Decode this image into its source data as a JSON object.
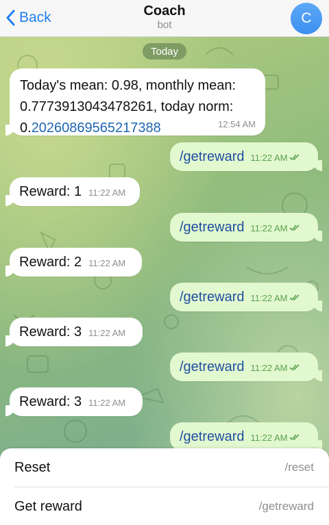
{
  "header": {
    "back_label": "Back",
    "title": "Coach",
    "subtitle": "bot",
    "avatar_letter": "C"
  },
  "date_separator": "Today",
  "messages": [
    {
      "direction": "incoming",
      "lines": [
        "Today's mean: 0.98, monthly mean:",
        "0.7773913043478261, today norm:"
      ],
      "link_prefix": "0.",
      "link_text": "20260869565217388",
      "time": "12:54 AM"
    },
    {
      "direction": "outgoing",
      "text": "/getreward",
      "time": "11:22 AM",
      "status": "read"
    },
    {
      "direction": "incoming",
      "text": "Reward: 1",
      "time": "11:22 AM"
    },
    {
      "direction": "outgoing",
      "text": "/getreward",
      "time": "11:22 AM",
      "status": "read"
    },
    {
      "direction": "incoming",
      "text": "Reward: 2",
      "time": "11:22 AM"
    },
    {
      "direction": "outgoing",
      "text": "/getreward",
      "time": "11:22 AM",
      "status": "read"
    },
    {
      "direction": "incoming",
      "text": "Reward: 3",
      "time": "11:22 AM"
    },
    {
      "direction": "outgoing",
      "text": "/getreward",
      "time": "11:22 AM",
      "status": "read"
    },
    {
      "direction": "incoming",
      "text": "Reward: 3",
      "time": "11:22 AM"
    },
    {
      "direction": "outgoing",
      "text": "/getreward",
      "time": "11:22 AM",
      "status": "read"
    }
  ],
  "commands": [
    {
      "label": "Reset",
      "command": "/reset"
    },
    {
      "label": "Get reward",
      "command": "/getreward"
    }
  ],
  "colors": {
    "accent": "#1f7ff0",
    "outgoing_bubble": "#e2f8cf",
    "incoming_bubble": "#ffffff",
    "read_check": "#5aa14e"
  }
}
